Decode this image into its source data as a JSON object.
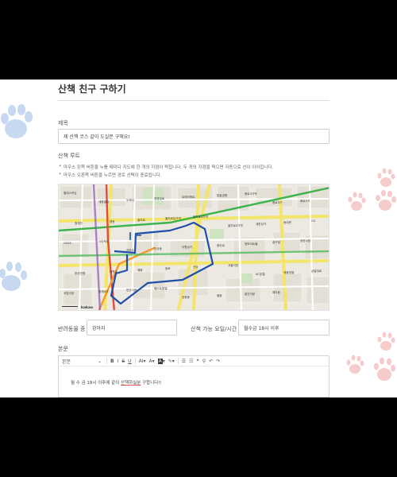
{
  "page": {
    "title": "산책 친구 구하기"
  },
  "form": {
    "subject": {
      "label": "제목",
      "value": "제 산책 코스 같이 도실분 구해요!"
    },
    "route": {
      "label": "산책 루트",
      "hints": [
        "마우스 왼쪽 버튼을 누를 때마다 지도에 한 개의 지점이 찍힙니다. 두 개의 지점을 찍으면 자동으로 선이 이어집니다.",
        "마우스 오른쪽 버튼을 누르면 경로 선택이 종료됩니다."
      ]
    },
    "pet": {
      "label": "반려동물 종",
      "value": "강아지"
    },
    "time": {
      "label": "산책 가능 요일/시간",
      "value": "월수금 18시 이후"
    },
    "body": {
      "label": "본문",
      "text_before": "월 수 금 18시 이후에 같이 ",
      "text_underlined": "산책하실분",
      "text_after": " 구합니다!!"
    }
  },
  "editor": {
    "paragraph_select": "본문",
    "align_label": "A"
  },
  "map": {
    "logo": "kakao",
    "route_color": "#1f4fa8",
    "places": [
      "힐데스하임",
      "세종빌딩",
      "우체국",
      "창경궁로",
      "르메이에르",
      "탑골공원",
      "종로3가역",
      "종로3가",
      "종로5가",
      "청계천",
      "명동",
      "을지로",
      "을지로입구역",
      "을지로3가역",
      "을지로4가역",
      "세운상가",
      "동대문",
      "CU",
      "GS25",
      "스타벅스",
      "카카오",
      "인사동",
      "낙원상가",
      "충무로",
      "명보아트홀",
      "중구청",
      "광장시장",
      "한국전쟁",
      "대학로",
      "혜화",
      "동묘",
      "신당",
      "서울지방",
      "AC호텔",
      "세종호텔",
      "삼일대로",
      "국립극장",
      "청계4가",
      "방산시장",
      "베스트호텔",
      "장충동",
      "필동",
      "흥인지문",
      "예지동"
    ]
  },
  "colors": {
    "paw_blue": "#c6d9f1",
    "paw_pink": "#f6cbcb",
    "map_bg": "#ece9e2"
  }
}
